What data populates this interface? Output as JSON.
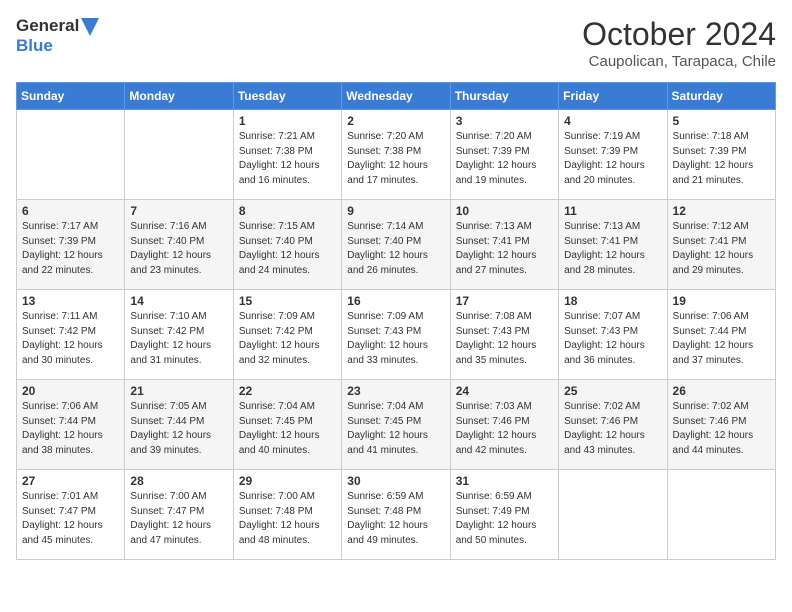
{
  "app": {
    "logo_general": "General",
    "logo_blue": "Blue"
  },
  "header": {
    "month": "October 2024",
    "location": "Caupolican, Tarapaca, Chile"
  },
  "days_of_week": [
    "Sunday",
    "Monday",
    "Tuesday",
    "Wednesday",
    "Thursday",
    "Friday",
    "Saturday"
  ],
  "weeks": [
    [
      {
        "day": "",
        "info": ""
      },
      {
        "day": "",
        "info": ""
      },
      {
        "day": "1",
        "info": "Sunrise: 7:21 AM\nSunset: 7:38 PM\nDaylight: 12 hours and 16 minutes."
      },
      {
        "day": "2",
        "info": "Sunrise: 7:20 AM\nSunset: 7:38 PM\nDaylight: 12 hours and 17 minutes."
      },
      {
        "day": "3",
        "info": "Sunrise: 7:20 AM\nSunset: 7:39 PM\nDaylight: 12 hours and 19 minutes."
      },
      {
        "day": "4",
        "info": "Sunrise: 7:19 AM\nSunset: 7:39 PM\nDaylight: 12 hours and 20 minutes."
      },
      {
        "day": "5",
        "info": "Sunrise: 7:18 AM\nSunset: 7:39 PM\nDaylight: 12 hours and 21 minutes."
      }
    ],
    [
      {
        "day": "6",
        "info": "Sunrise: 7:17 AM\nSunset: 7:39 PM\nDaylight: 12 hours and 22 minutes."
      },
      {
        "day": "7",
        "info": "Sunrise: 7:16 AM\nSunset: 7:40 PM\nDaylight: 12 hours and 23 minutes."
      },
      {
        "day": "8",
        "info": "Sunrise: 7:15 AM\nSunset: 7:40 PM\nDaylight: 12 hours and 24 minutes."
      },
      {
        "day": "9",
        "info": "Sunrise: 7:14 AM\nSunset: 7:40 PM\nDaylight: 12 hours and 26 minutes."
      },
      {
        "day": "10",
        "info": "Sunrise: 7:13 AM\nSunset: 7:41 PM\nDaylight: 12 hours and 27 minutes."
      },
      {
        "day": "11",
        "info": "Sunrise: 7:13 AM\nSunset: 7:41 PM\nDaylight: 12 hours and 28 minutes."
      },
      {
        "day": "12",
        "info": "Sunrise: 7:12 AM\nSunset: 7:41 PM\nDaylight: 12 hours and 29 minutes."
      }
    ],
    [
      {
        "day": "13",
        "info": "Sunrise: 7:11 AM\nSunset: 7:42 PM\nDaylight: 12 hours and 30 minutes."
      },
      {
        "day": "14",
        "info": "Sunrise: 7:10 AM\nSunset: 7:42 PM\nDaylight: 12 hours and 31 minutes."
      },
      {
        "day": "15",
        "info": "Sunrise: 7:09 AM\nSunset: 7:42 PM\nDaylight: 12 hours and 32 minutes."
      },
      {
        "day": "16",
        "info": "Sunrise: 7:09 AM\nSunset: 7:43 PM\nDaylight: 12 hours and 33 minutes."
      },
      {
        "day": "17",
        "info": "Sunrise: 7:08 AM\nSunset: 7:43 PM\nDaylight: 12 hours and 35 minutes."
      },
      {
        "day": "18",
        "info": "Sunrise: 7:07 AM\nSunset: 7:43 PM\nDaylight: 12 hours and 36 minutes."
      },
      {
        "day": "19",
        "info": "Sunrise: 7:06 AM\nSunset: 7:44 PM\nDaylight: 12 hours and 37 minutes."
      }
    ],
    [
      {
        "day": "20",
        "info": "Sunrise: 7:06 AM\nSunset: 7:44 PM\nDaylight: 12 hours and 38 minutes."
      },
      {
        "day": "21",
        "info": "Sunrise: 7:05 AM\nSunset: 7:44 PM\nDaylight: 12 hours and 39 minutes."
      },
      {
        "day": "22",
        "info": "Sunrise: 7:04 AM\nSunset: 7:45 PM\nDaylight: 12 hours and 40 minutes."
      },
      {
        "day": "23",
        "info": "Sunrise: 7:04 AM\nSunset: 7:45 PM\nDaylight: 12 hours and 41 minutes."
      },
      {
        "day": "24",
        "info": "Sunrise: 7:03 AM\nSunset: 7:46 PM\nDaylight: 12 hours and 42 minutes."
      },
      {
        "day": "25",
        "info": "Sunrise: 7:02 AM\nSunset: 7:46 PM\nDaylight: 12 hours and 43 minutes."
      },
      {
        "day": "26",
        "info": "Sunrise: 7:02 AM\nSunset: 7:46 PM\nDaylight: 12 hours and 44 minutes."
      }
    ],
    [
      {
        "day": "27",
        "info": "Sunrise: 7:01 AM\nSunset: 7:47 PM\nDaylight: 12 hours and 45 minutes."
      },
      {
        "day": "28",
        "info": "Sunrise: 7:00 AM\nSunset: 7:47 PM\nDaylight: 12 hours and 47 minutes."
      },
      {
        "day": "29",
        "info": "Sunrise: 7:00 AM\nSunset: 7:48 PM\nDaylight: 12 hours and 48 minutes."
      },
      {
        "day": "30",
        "info": "Sunrise: 6:59 AM\nSunset: 7:48 PM\nDaylight: 12 hours and 49 minutes."
      },
      {
        "day": "31",
        "info": "Sunrise: 6:59 AM\nSunset: 7:49 PM\nDaylight: 12 hours and 50 minutes."
      },
      {
        "day": "",
        "info": ""
      },
      {
        "day": "",
        "info": ""
      }
    ]
  ]
}
